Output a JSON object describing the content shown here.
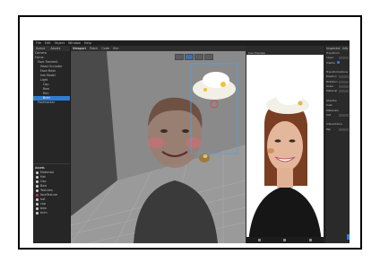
{
  "app": {
    "menu": [
      "File",
      "Edit",
      "Object",
      "Window",
      "Help"
    ]
  },
  "left_panel": {
    "tabs": [
      "Scene",
      "Assets"
    ],
    "tree": [
      {
        "label": "Camera",
        "indent": 0,
        "selected": false
      },
      {
        "label": "Focus",
        "indent": 0,
        "selected": false
      },
      {
        "label": "Face Tracker0",
        "indent": 1,
        "selected": false
      },
      {
        "label": "Head Occluder",
        "indent": 2,
        "selected": false
      },
      {
        "label": "Face Mesh",
        "indent": 2,
        "selected": false
      },
      {
        "label": "Hat Model",
        "indent": 2,
        "selected": false
      },
      {
        "label": "Light",
        "indent": 2,
        "selected": false
      },
      {
        "label": "Cap",
        "indent": 3,
        "selected": false
      },
      {
        "label": "Bow",
        "indent": 3,
        "selected": false
      },
      {
        "label": "Rim",
        "indent": 3,
        "selected": false
      },
      {
        "label": "Brim",
        "indent": 3,
        "selected": true
      },
      {
        "label": "Facetracker",
        "indent": 1,
        "selected": false
      }
    ],
    "assets_header": "Assets",
    "assets": [
      {
        "label": "Materials",
        "color": "#d0d0d0"
      },
      {
        "label": "Hat",
        "color": "#d0d0d0"
      },
      {
        "label": "Cap",
        "color": "#d0d0d0"
      },
      {
        "label": "Bow",
        "color": "#d0d0d0"
      },
      {
        "label": "Textures",
        "color": "#d0d0d0"
      },
      {
        "label": "faceTexture",
        "color": "#d53a3a"
      },
      {
        "label": "hat",
        "color": "#d0d0d0"
      },
      {
        "label": "cap",
        "color": "#d0d0d0"
      },
      {
        "label": "bow",
        "color": "#d0d0d0"
      },
      {
        "label": "brim",
        "color": "#d0d0d0"
      }
    ]
  },
  "viewport": {
    "tabs": [
      {
        "label": "Viewport",
        "active": true
      },
      {
        "label": "Patch",
        "active": false
      },
      {
        "label": "Code",
        "active": false
      },
      {
        "label": "Sim",
        "active": false
      }
    ]
  },
  "preview": {
    "title": "Live Preview"
  },
  "right_panel": {
    "tabs": [
      "Inspector",
      "Info"
    ],
    "rows": [
      {
        "label": "Transform",
        "field": false,
        "toggle": false
      },
      {
        "label": "Layer",
        "field": true,
        "toggle": false
      },
      {
        "label": "Visible",
        "field": false,
        "toggle": true
      },
      {
        "label": "",
        "field": false,
        "toggle": false
      },
      {
        "label": "Transformations",
        "field": false,
        "toggle": false
      },
      {
        "label": "Position",
        "field": true,
        "toggle": false
      },
      {
        "label": "Rotation",
        "field": true,
        "toggle": false
      },
      {
        "label": "Scale",
        "field": true,
        "toggle": false
      },
      {
        "label": "Material",
        "field": true,
        "toggle": false
      },
      {
        "label": "",
        "field": false,
        "toggle": false
      },
      {
        "label": "Shadow",
        "field": false,
        "toggle": false
      },
      {
        "label": "Cast",
        "field": false,
        "toggle": false
      },
      {
        "label": "Materials",
        "field": false,
        "toggle": false
      },
      {
        "label": "hat",
        "field": true,
        "toggle": false
      },
      {
        "label": "",
        "field": false,
        "toggle": false
      },
      {
        "label": "Interactions",
        "field": false,
        "toggle": false
      },
      {
        "label": "Tap",
        "field": true,
        "toggle": false
      }
    ]
  },
  "colors": {
    "selection": "#2f7dd1",
    "panel_bg": "#262626",
    "viewport_bg": "#707070"
  }
}
